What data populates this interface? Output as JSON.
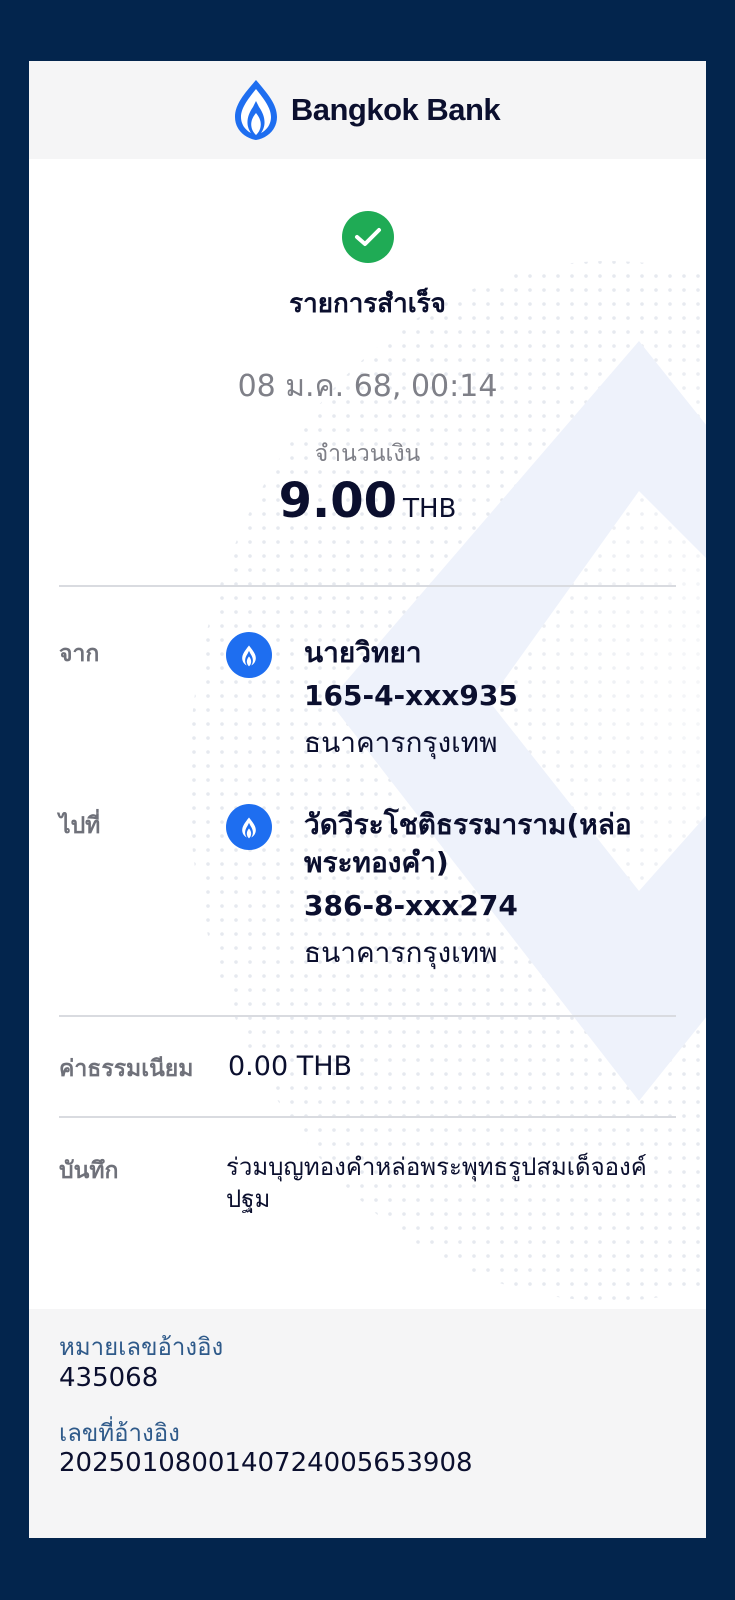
{
  "brand": {
    "name": "Bangkok Bank"
  },
  "status": {
    "title": "รายการสำเร็จ",
    "icon": "check-icon",
    "color": "#1fab55"
  },
  "datetime": "08 ม.ค. 68, 00:14",
  "amount": {
    "label": "จำนวนเงิน",
    "value": "9.00",
    "currency": "THB"
  },
  "from": {
    "label": "จาก",
    "name": "นายวิทยา",
    "account": "165-4-xxx935",
    "bank": "ธนาคารกรุงเทพ",
    "icon": "bangkok-bank-icon"
  },
  "to": {
    "label": "ไปที่",
    "name": "วัดวีระโชติธรรมาราม(หล่อพระทองคำ)",
    "account": "386-8-xxx274",
    "bank": "ธนาคารกรุงเทพ",
    "icon": "bangkok-bank-icon"
  },
  "fee": {
    "label": "ค่าธรรมเนียม",
    "value": "0.00 THB"
  },
  "memo": {
    "label": "บันทึก",
    "text": "ร่วมบุญทองคำหล่อพระพุทธรูปสมเด็จองค์ปฐม"
  },
  "reference": {
    "ref_no_label": "หมายเลขอ้างอิง",
    "ref_no": "435068",
    "ref_id_label": "เลขที่อ้างอิง",
    "ref_id": "202501080014072400565390​8"
  },
  "colors": {
    "frame": "#03254d",
    "brand_blue": "#1e6ef0",
    "text": "#0b0f2e",
    "muted": "#7f8088"
  }
}
